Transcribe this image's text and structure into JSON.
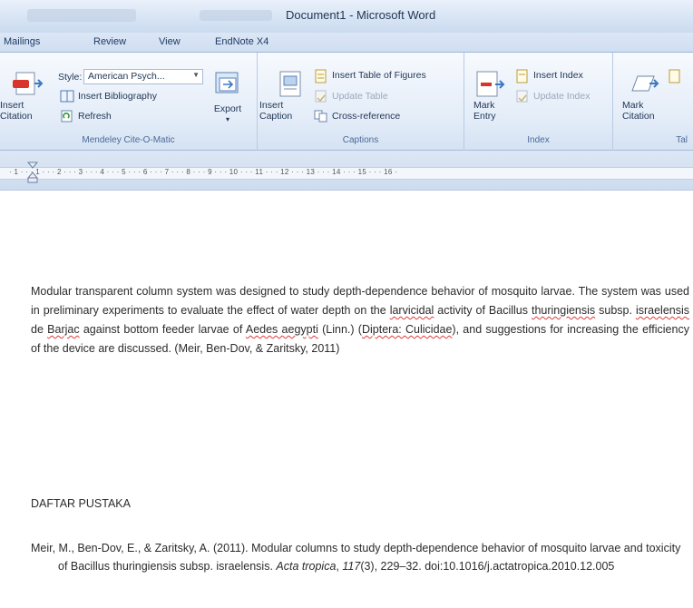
{
  "window": {
    "title": "Document1 - Microsoft Word"
  },
  "tabs": [
    "Mailings",
    "Review",
    "View",
    "EndNote X4"
  ],
  "ribbon": {
    "mendeley": {
      "insert_citation": "Insert Citation",
      "style_label": "Style:",
      "style_value": "American Psych...",
      "insert_bibliography": "Insert Bibliography",
      "refresh": "Refresh",
      "export": "Export",
      "group_label": "Mendeley Cite-O-Matic"
    },
    "captions": {
      "insert_caption": "Insert Caption",
      "insert_table_of_figures": "Insert Table of Figures",
      "update_table": "Update Table",
      "cross_reference": "Cross-reference",
      "group_label": "Captions"
    },
    "index": {
      "mark_entry": "Mark Entry",
      "insert_index": "Insert Index",
      "update_index": "Update Index",
      "group_label": "Index"
    },
    "toa": {
      "mark_citation": "Mark Citation",
      "group_label": "Tal"
    }
  },
  "ruler": {
    "marks": "· 1 · · · 1 · · · 2 · · · 3 · · · 4 · · · 5 · · · 6 · · · 7 · · · 8 · · · 9 · · · 10 · · · 11 · · · 12 · · · 13 · · · 14 · · · 15 · · · 16 ·"
  },
  "document": {
    "p1a": "Modular transparent column system was designed to study depth-dependence behavior of mosquito larvae. The system was used in preliminary experiments to evaluate the effect of water depth on the ",
    "p1_larvicidal": "larvicidal",
    "p1b": " activity of Bacillus ",
    "p1_thuringiensis": "thuringiensis",
    "p1c": " subsp. ",
    "p1_israelensis": "israelensis",
    "p1d": " de ",
    "p1_barjac": "Barjac",
    "p1e": " against bottom feeder larvae of ",
    "p1_aedes": "Aedes aegypti",
    "p1f": " (Linn.) (",
    "p1_diptera": "Diptera: Culicidae",
    "p1g": "), and suggestions for increasing the efficiency of the device are discussed. (Meir, Ben-Dov, & Zaritsky, 2011)",
    "heading": "DAFTAR PUSTAKA",
    "ref_a": "Meir, M., Ben-Dov, E., & Zaritsky, A. (2011). Modular columns to study depth-dependence behavior of mosquito larvae and toxicity of Bacillus thuringiensis subsp. israelensis. ",
    "ref_journal": "Acta tropica",
    "ref_sep": ", ",
    "ref_vol": "117",
    "ref_b": "(3), 229–32. doi:10.1016/j.actatropica.2010.12.005"
  }
}
